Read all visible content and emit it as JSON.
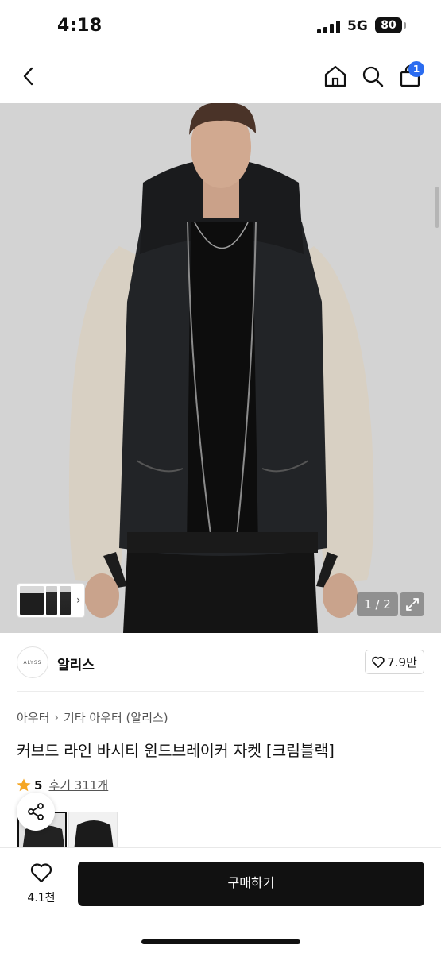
{
  "status_bar": {
    "time": "4:18",
    "network": "5G",
    "battery": "80"
  },
  "nav": {
    "back_icon": "chevron-left-icon",
    "home_icon": "home-icon",
    "search_icon": "search-icon",
    "cart_icon": "shopping-bag-icon",
    "cart_badge": "1"
  },
  "gallery": {
    "counter": "1 / 2",
    "current_page": 1,
    "total_pages": 2,
    "expand_icon": "expand-icon"
  },
  "brand": {
    "logo_text": "ALYSS",
    "name": "알리스",
    "like_count": "7.9만"
  },
  "product": {
    "breadcrumb": [
      "아우터",
      "기타 아우터 (알리스)"
    ],
    "title": "커브드 라인 바시티 윈드브레이커 자켓 [크림블랙]",
    "rating": "5",
    "reviews": "후기 311개"
  },
  "bottom_bar": {
    "wish_count": "4.1천",
    "buy_label": "구매하기"
  },
  "colors": {
    "accent_badge": "#2b6cf0",
    "star": "#f5a623",
    "buy_button": "#111111"
  }
}
